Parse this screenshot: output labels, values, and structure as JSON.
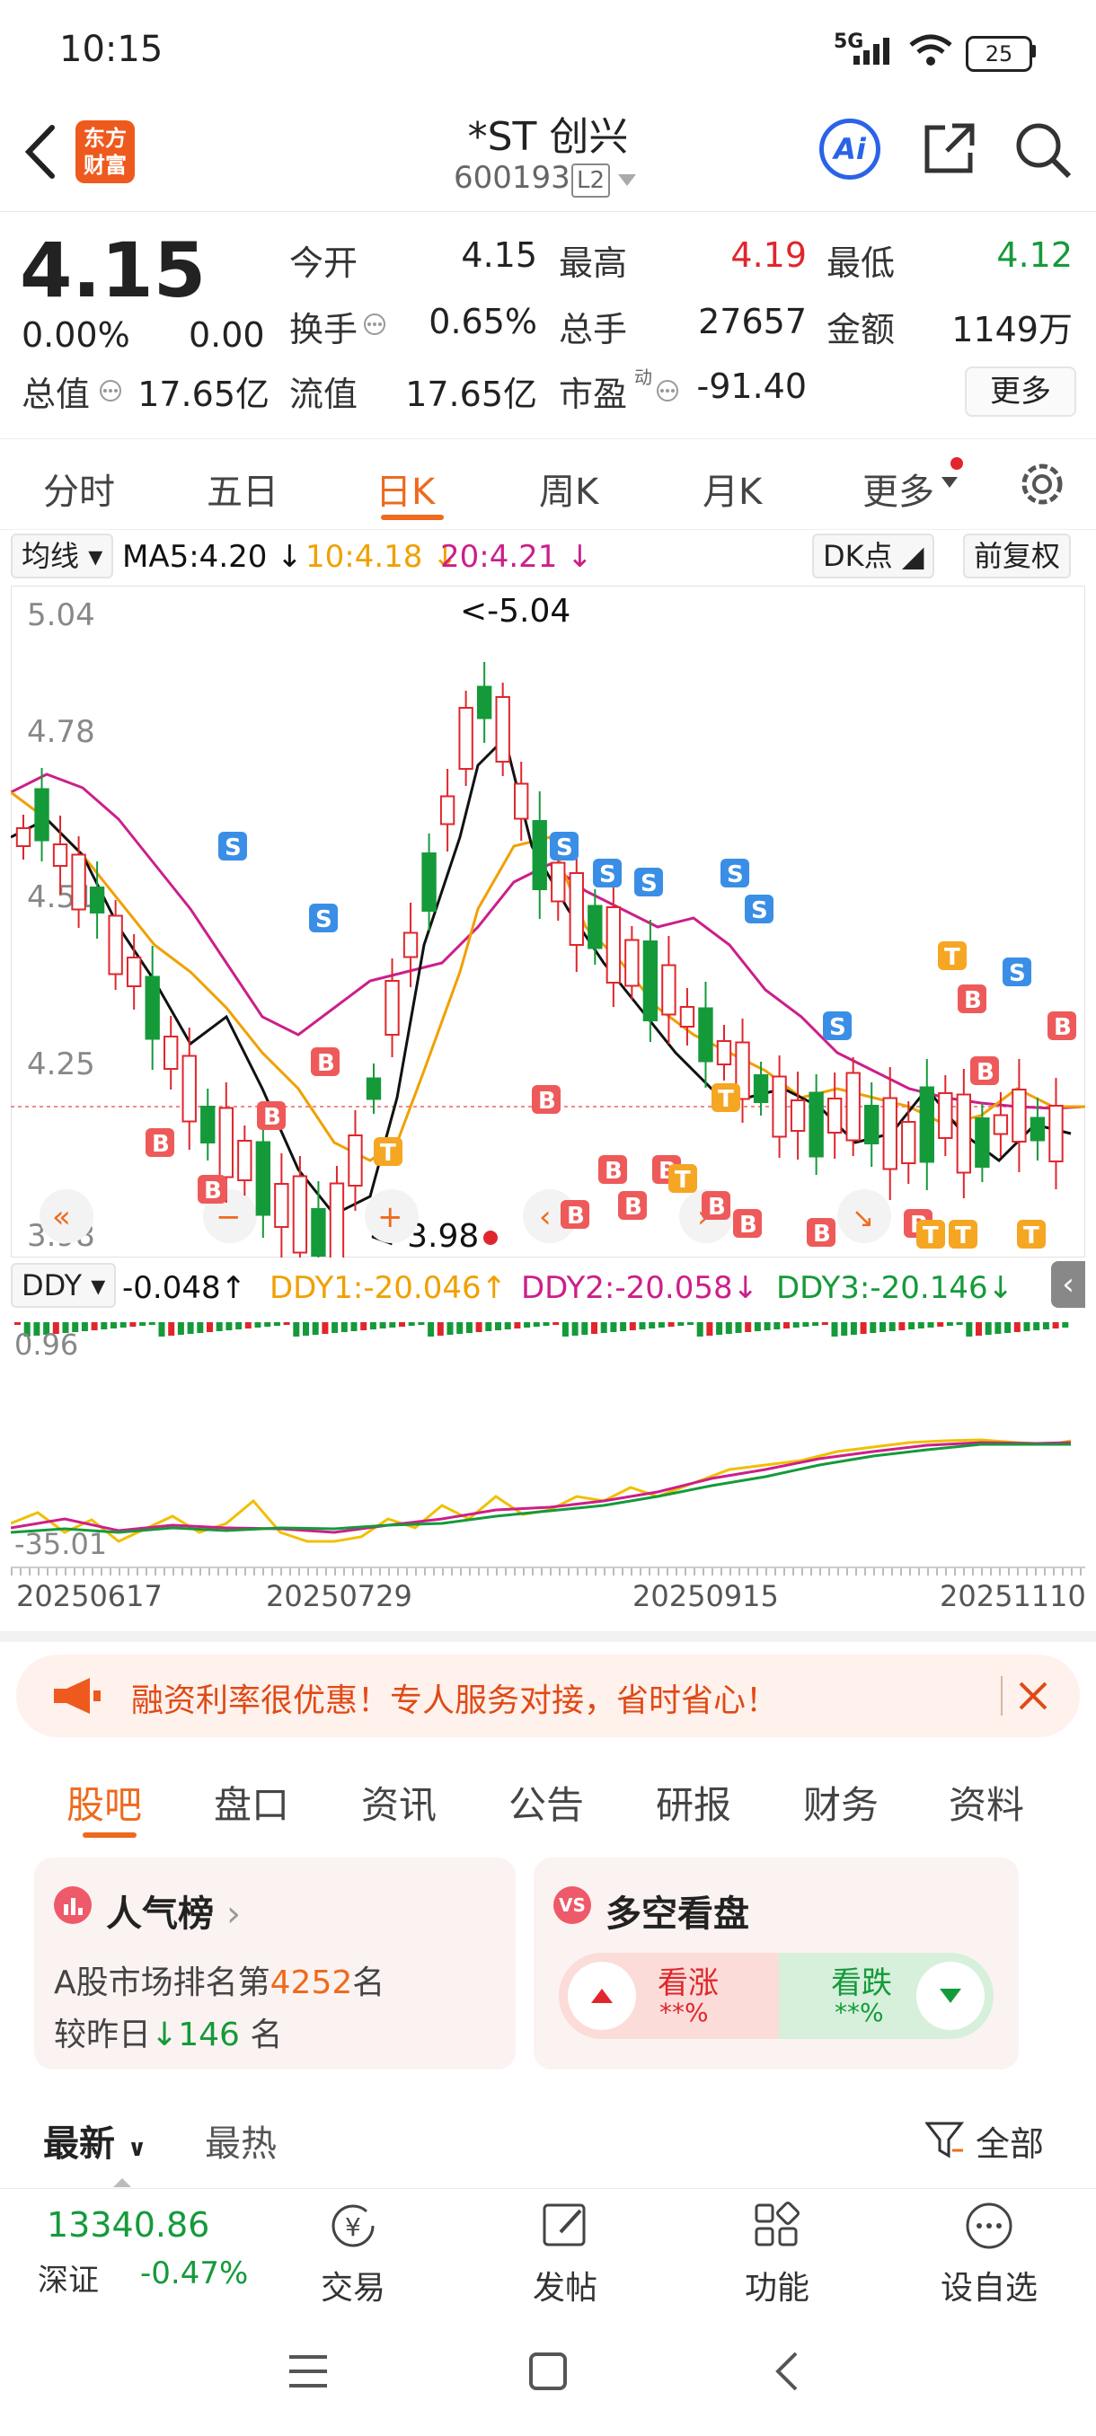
{
  "status": {
    "time": "10:15",
    "network": "5G",
    "battery": "25"
  },
  "header": {
    "logo_line1": "东方",
    "logo_line2": "财富",
    "title": "*ST 创兴",
    "code": "600193",
    "level": "L2",
    "ai": "Ai"
  },
  "quote": {
    "price": "4.15",
    "change_pct": "0.00%",
    "change": "0.00",
    "open_label": "今开",
    "open": "4.15",
    "high_label": "最高",
    "high": "4.19",
    "low_label": "最低",
    "low": "4.12",
    "turnover_label": "换手",
    "turnover": "0.65%",
    "volume_label": "总手",
    "volume": "27657",
    "amount_label": "金额",
    "amount": "1149万",
    "mcap_label": "总值",
    "mcap": "17.65亿",
    "float_label": "流值",
    "float": "17.65亿",
    "pe_label": "市盈",
    "pe_sup": "动",
    "pe": "-91.40",
    "more": "更多"
  },
  "tabs": [
    "分时",
    "五日",
    "日K",
    "周K",
    "月K",
    "更多"
  ],
  "active_tab": "日K",
  "legend": {
    "ma_select": "均线",
    "ma5": "MA5:4.20",
    "ma10": "10:4.18",
    "ma20": "20:4.21",
    "dk": "DK点",
    "fq": "前复权"
  },
  "kline": {
    "y_labels": [
      "5.04",
      "4.78",
      "4.51",
      "4.25",
      "3.98"
    ],
    "max_label": "<-5.04",
    "min_label": "<-3.98",
    "center_label": "4.25"
  },
  "ddy": {
    "select": "DDY",
    "v": "-0.048",
    "ddy1": "DDY1:-20.046",
    "ddy2": "DDY2:-20.058",
    "ddy3": "DDY3:-20.146",
    "top": "0.96",
    "bottom": "-35.01"
  },
  "dates": [
    "20250617",
    "20250729",
    "20250915",
    "20251110"
  ],
  "promo": {
    "text": "融资利率很优惠！专人服务对接，省时省心！"
  },
  "content_tabs": [
    "股吧",
    "盘口",
    "资讯",
    "公告",
    "研报",
    "财务",
    "资料"
  ],
  "active_content_tab": "股吧",
  "card_popular": {
    "title": "人气榜",
    "line1_pre": "A股市场排名第",
    "rank": "4252",
    "line1_post": "名",
    "line2_pre": "较昨日",
    "delta": "146",
    "line2_post": "名"
  },
  "card_vote": {
    "title": "多空看盘",
    "up": "看涨",
    "up_val": "**%",
    "down": "看跌",
    "down_val": "**%"
  },
  "sort": {
    "latest": "最新",
    "hot": "最热",
    "all": "全部"
  },
  "index": {
    "value": "13340.86",
    "name": "深证",
    "pct": "-0.47%"
  },
  "bottom_items": [
    "交易",
    "发帖",
    "功能",
    "设自选"
  ],
  "colors": {
    "up": "#e0262c",
    "down": "#159a3a",
    "accent": "#ee6a1e",
    "ma5": "#111111",
    "ma10": "#f0a000",
    "ma20": "#cc1f8a",
    "ai_blue": "#2a63e8"
  }
}
